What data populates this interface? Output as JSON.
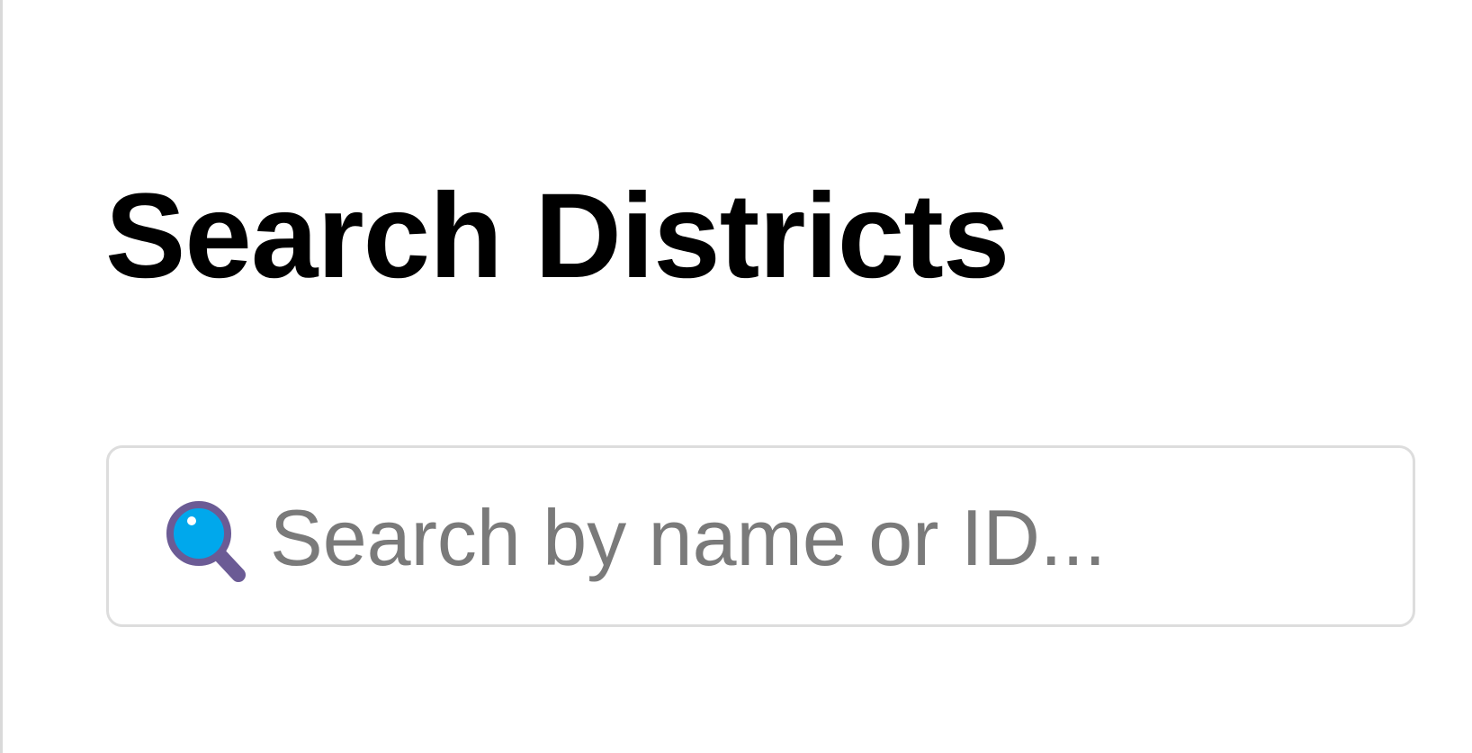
{
  "header": {
    "title": "Search Districts"
  },
  "search": {
    "placeholder": "Search by name or ID...",
    "value": "",
    "icon": "search-icon"
  },
  "colors": {
    "title_text": "#000000",
    "placeholder_text": "#7a7a7a",
    "input_border": "#dddddd",
    "icon_lens": "#00a8ec",
    "icon_handle": "#6b5b95"
  }
}
